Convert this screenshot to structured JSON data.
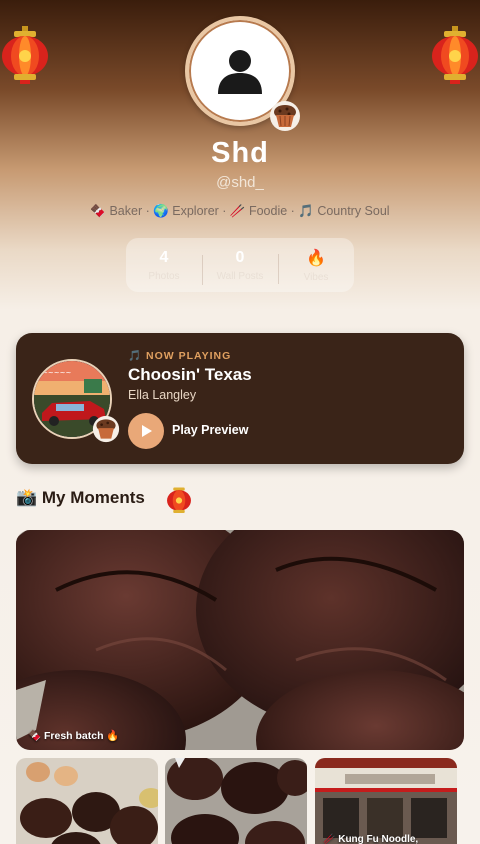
{
  "profile": {
    "name": "Shd",
    "handle": "@shd_",
    "tags": "🍫 Baker · 🌍 Explorer · 🥢 Foodie · 🎵 Country Soul"
  },
  "stats": [
    {
      "value": "4",
      "label": "Photos"
    },
    {
      "value": "0",
      "label": "Wall Posts"
    },
    {
      "value": "🔥",
      "label": "Vibes"
    }
  ],
  "now_playing": {
    "label": "🎵 NOW PLAYING",
    "title": "Choosin' Texas",
    "artist": "Ella Langley",
    "play_label": "Play Preview"
  },
  "moments": {
    "title": "📸 My Moments",
    "main_caption": "🍫 Fresh batch 🔥",
    "thumbs": [
      {
        "caption": ""
      },
      {
        "caption": ""
      },
      {
        "caption": "🥢 Kung Fu Noodle,"
      }
    ]
  },
  "icons": {
    "avatar": "user-silhouette-icon",
    "badge": "muffin-icon",
    "lantern": "red-lantern-icon",
    "play": "play-icon"
  },
  "colors": {
    "card_bg": "#3a2418",
    "accent": "#e9a878",
    "label_accent": "#e0a060"
  }
}
